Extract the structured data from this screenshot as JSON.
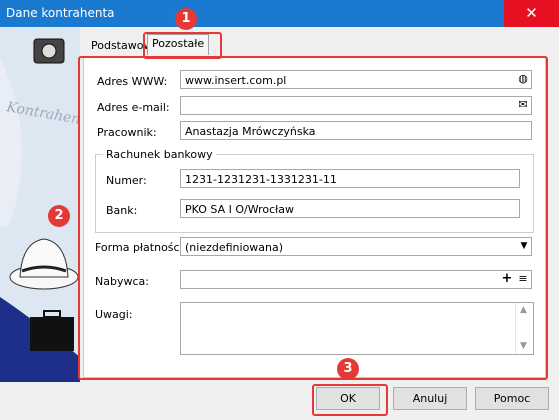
{
  "window": {
    "title": "Dane kontrahenta",
    "close_glyph": "✕"
  },
  "sidebar": {
    "logo_text": "Kontrahent"
  },
  "tabs": [
    {
      "label": "Podstawowe"
    },
    {
      "label": "Pozostałe"
    }
  ],
  "fields": {
    "www": {
      "label": "Adres WWW:",
      "value": "www.insert.com.pl",
      "icon": "globe-icon"
    },
    "email": {
      "label": "Adres e-mail:",
      "value": "",
      "icon": "envelope-icon"
    },
    "pracownik": {
      "label": "Pracownik:",
      "value": "Anastazja Mrówczyńska"
    },
    "rachunek": {
      "group_label": "Rachunek bankowy",
      "numer_label": "Numer:",
      "numer_value": "1231-1231231-1331231-11",
      "bank_label": "Bank:",
      "bank_value": "PKO SA I O/Wrocław"
    },
    "forma": {
      "label": "Forma płatności:",
      "value": "(niezdefiniowana)"
    },
    "nabywca": {
      "label": "Nabywca:",
      "value": "",
      "add_glyph": "+",
      "list_glyph": "≡"
    },
    "uwagi": {
      "label": "Uwagi:",
      "value": ""
    }
  },
  "buttons": {
    "ok": "OK",
    "cancel": "Anuluj",
    "help": "Pomoc"
  },
  "annotations": {
    "badge1": "1",
    "badge2": "2",
    "badge3": "3",
    "color": "#e53935"
  }
}
